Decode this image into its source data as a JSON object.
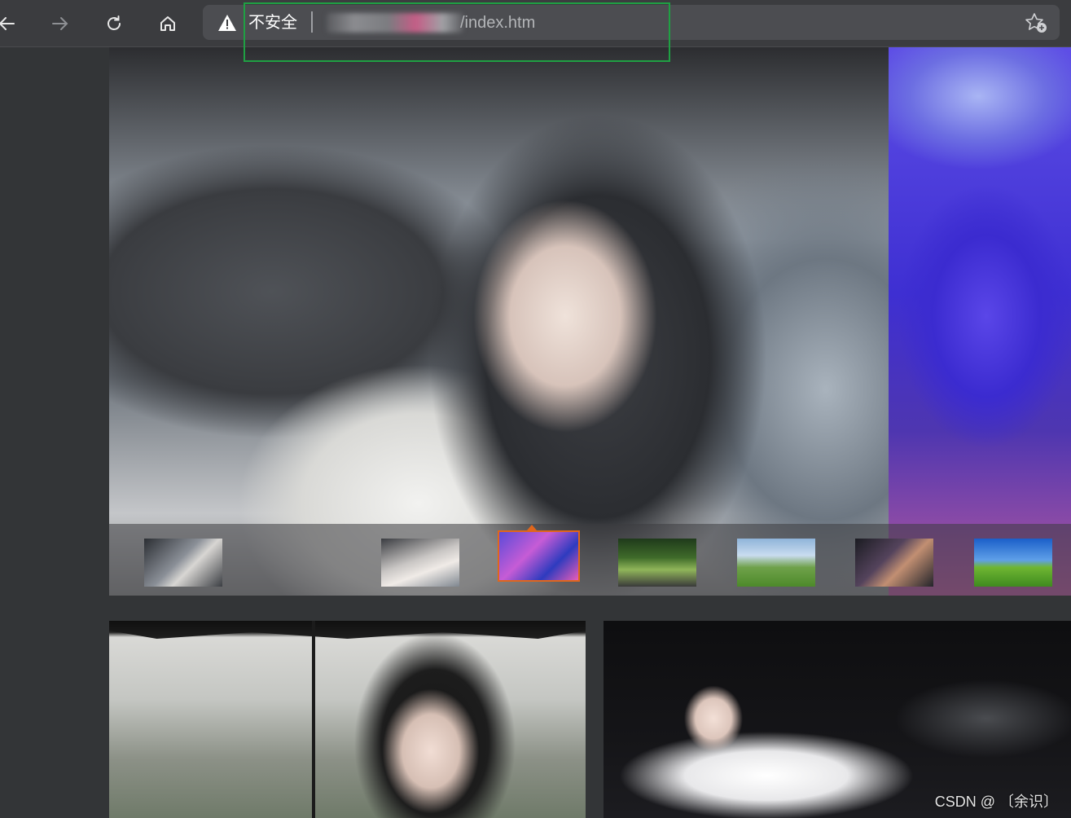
{
  "browser": {
    "nav": {
      "back_icon": "arrow-left-icon",
      "forward_icon": "arrow-right-icon",
      "reload_icon": "reload-icon",
      "home_icon": "home-icon"
    },
    "address_bar": {
      "security_icon": "warning-triangle-icon",
      "security_label": "不安全",
      "separator": "|",
      "url_path": "/index.htm",
      "favorite_icon": "star-add-icon"
    },
    "highlight_color": "#1fa043"
  },
  "page": {
    "background": "#333537",
    "carousel": {
      "thumbnails": [
        {
          "name": "thumb-1",
          "active": false
        },
        {
          "name": "thumb-2",
          "active": false
        },
        {
          "name": "thumb-3",
          "active": true
        },
        {
          "name": "thumb-4",
          "active": false
        },
        {
          "name": "thumb-5",
          "active": false
        },
        {
          "name": "thumb-6",
          "active": false
        },
        {
          "name": "thumb-7",
          "active": false
        }
      ],
      "active_border_color": "#e0661c"
    },
    "photos": [
      {
        "name": "photo-umbrella"
      },
      {
        "name": "photo-dancer"
      }
    ],
    "watermark": "CSDN @ 〔余识〕"
  }
}
